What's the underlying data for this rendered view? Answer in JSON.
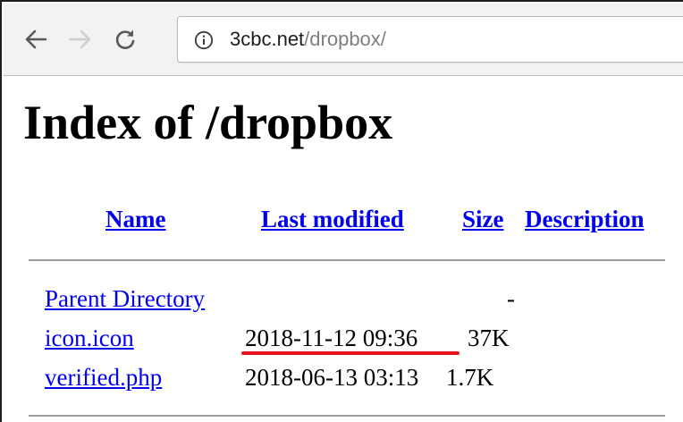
{
  "browser": {
    "url_host": "3cbc.net",
    "url_path": "/dropbox/",
    "icons": {
      "back": "arrow-left-icon",
      "forward": "arrow-right-icon",
      "reload": "reload-icon",
      "site_info": "info-circle-icon"
    }
  },
  "page": {
    "title": "Index of /dropbox",
    "columns": {
      "name": "Name",
      "last_modified": "Last modified",
      "size": "Size",
      "description": "Description"
    },
    "parent_directory": {
      "label": "Parent Directory",
      "size": "-"
    },
    "files": [
      {
        "name": "icon.icon",
        "modified": "2018-11-12 09:36",
        "size": "37K"
      },
      {
        "name": "verified.php",
        "modified": "2018-06-13 03:13",
        "size": "1.7K"
      }
    ]
  },
  "colors": {
    "link": "#0000ee",
    "annotation": "#e3141b",
    "toolbar": "#f2f2f2"
  }
}
